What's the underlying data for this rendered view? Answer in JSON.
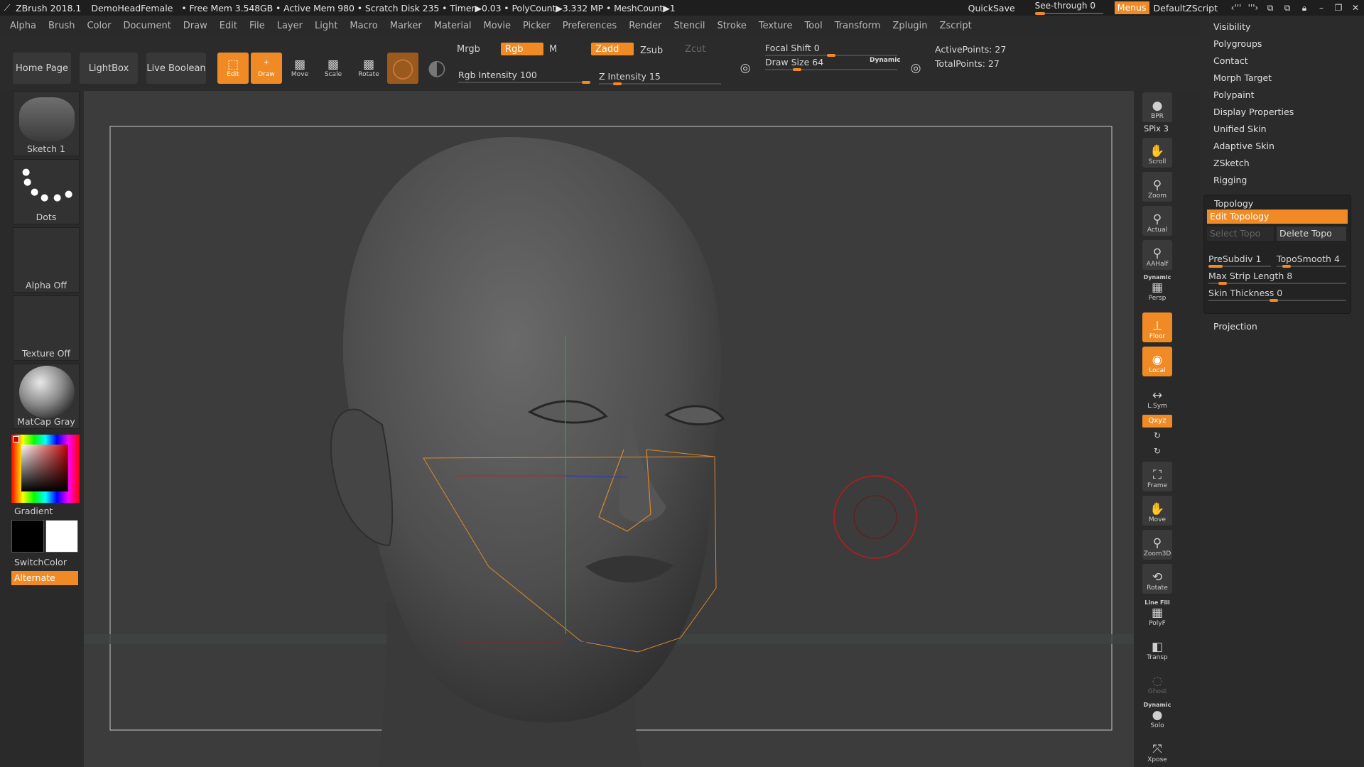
{
  "titlebar": {
    "app": "ZBrush 2018.1",
    "document": "DemoHeadFemale",
    "status": "• Free Mem 3.548GB • Active Mem 980 • Scratch Disk 235 • Timer▶0.03 • PolyCount▶3.332 MP • MeshCount▶1",
    "quicksave": "QuickSave",
    "see_through": "See-through  0",
    "see_through_value": 0,
    "menus": "Menus",
    "script": "DefaultZScript"
  },
  "menu": [
    "Alpha",
    "Brush",
    "Color",
    "Document",
    "Draw",
    "Edit",
    "File",
    "Layer",
    "Light",
    "Macro",
    "Marker",
    "Material",
    "Movie",
    "Picker",
    "Preferences",
    "Render",
    "Stencil",
    "Stroke",
    "Texture",
    "Tool",
    "Transform",
    "Zplugin",
    "Zscript"
  ],
  "shelf": {
    "home": "Home Page",
    "lightbox": "LightBox",
    "live_boolean": "Live Boolean",
    "edit": "Edit",
    "draw": "Draw",
    "move": "Move",
    "scale": "Scale",
    "rotate": "Rotate",
    "mrgb": "Mrgb",
    "rgb": "Rgb",
    "m": "M",
    "zadd": "Zadd",
    "zsub": "Zsub",
    "zcut": "Zcut",
    "rgb_intensity": "Rgb Intensity 100",
    "rgb_intensity_value": 100,
    "z_intensity": "Z Intensity 15",
    "z_intensity_value": 15,
    "focal_shift": "Focal Shift 0",
    "focal_shift_value": 0,
    "draw_size": "Draw Size 64",
    "draw_size_value": 64,
    "dynamic": "Dynamic",
    "active_points": "ActivePoints: 27",
    "total_points": "TotalPoints: 27"
  },
  "lefttray": {
    "sketch": "Sketch 1",
    "dots": "Dots",
    "alpha": "Alpha Off",
    "texture": "Texture Off",
    "matcap": "MatCap Gray",
    "gradient": "Gradient",
    "switchcolor": "SwitchColor",
    "alternate": "Alternate"
  },
  "righttray": {
    "bpr": "BPR",
    "spix": "SPix 3",
    "scroll": "Scroll",
    "zoom": "Zoom",
    "actual": "Actual",
    "aahalf": "AAHalf",
    "dynamic": "Dynamic",
    "persp": "Persp",
    "floor": "Floor",
    "local": "Local",
    "lsym": "L.Sym",
    "xyz": "Qxyz",
    "frame": "Frame",
    "move": "Move",
    "zoom3d": "Zoom3D",
    "rotate": "Rotate",
    "linefill": "Line Fill",
    "polyf": "PolyF",
    "transp": "Transp",
    "ghost": "Ghost",
    "dynamic2": "Dynamic",
    "solo": "Solo",
    "xpose": "Xpose"
  },
  "palette": {
    "items_top": [
      "Visibility",
      "Polygroups",
      "Contact",
      "Morph Target",
      "Polypaint",
      "Display Properties",
      "Unified Skin",
      "Adaptive Skin",
      "ZSketch",
      "Rigging"
    ],
    "topology": "Topology",
    "edit_topology": "Edit Topology",
    "select_topo": "Select Topo",
    "delete_topo": "Delete Topo",
    "presubdiv": "PreSubdiv 1",
    "topo_smooth": "TopoSmooth 4",
    "max_strip": "Max Strip Length 8",
    "skin_thickness": "Skin Thickness 0",
    "projection": "Projection"
  },
  "colors": {
    "accent": "#f08a24",
    "background": "#2b2b2b",
    "viewport": "#3c3c3c"
  }
}
